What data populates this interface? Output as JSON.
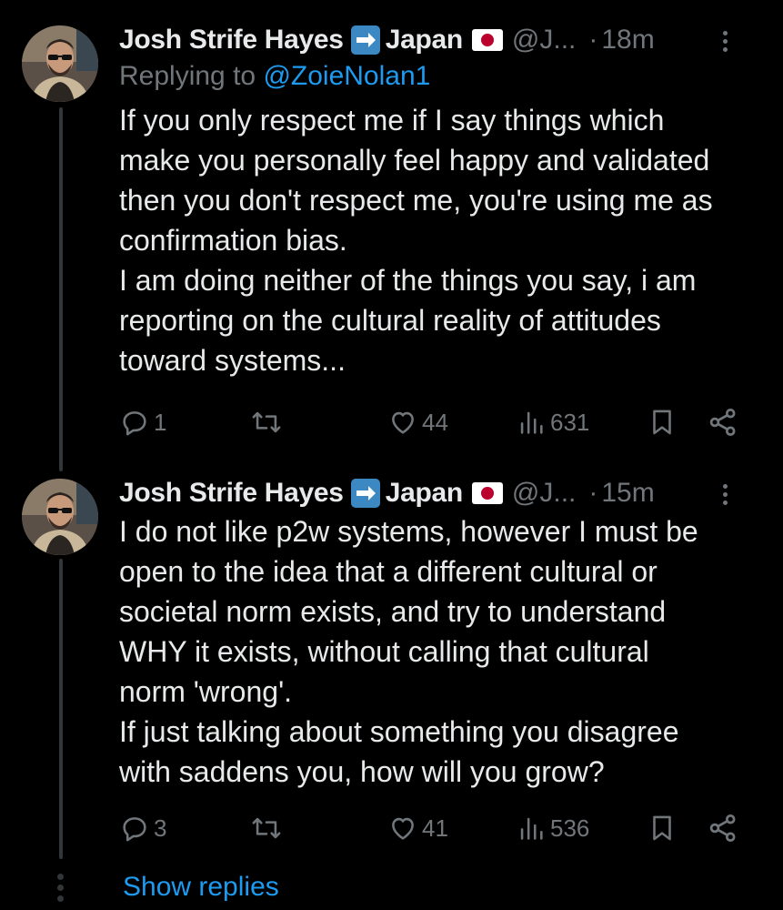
{
  "tweets": [
    {
      "author": {
        "name": "Josh Strife Hayes",
        "arrow_emoji": "right-arrow-emoji",
        "location": "Japan",
        "flag_emoji": "japan-flag-emoji",
        "handle": "@J...",
        "separator": "·",
        "time": "18m"
      },
      "reply_to": {
        "prefix": "Replying to ",
        "mention": "@ZoieNolan1"
      },
      "text": "If you only respect me if I say things which\nmake you personally feel happy and validated\nthen you don't respect me, you're using me as\nconfirmation bias.\nI am doing neither of the things you say, i am\nreporting on the cultural reality of attitudes\ntoward systems...",
      "actions": {
        "replies": "1",
        "reposts": "",
        "likes": "44",
        "views": "631"
      }
    },
    {
      "author": {
        "name": "Josh Strife Hayes",
        "arrow_emoji": "right-arrow-emoji",
        "location": "Japan",
        "flag_emoji": "japan-flag-emoji",
        "handle": "@J...",
        "separator": "·",
        "time": "15m"
      },
      "text": "I do not like p2w systems, however I must be\nopen to the idea that a different cultural or\nsocietal norm exists, and try to understand\nWHY it exists, without calling that cultural\nnorm 'wrong'.\nIf just talking about something you disagree\nwith saddens you, how will you grow?",
      "actions": {
        "replies": "3",
        "reposts": "",
        "likes": "41",
        "views": "536"
      }
    }
  ],
  "show_replies_label": "Show replies",
  "colors": {
    "background": "#000000",
    "text": "#e7e9ea",
    "muted": "#71767b",
    "accent": "#1d9bf0",
    "thread_line": "#333639"
  },
  "icons": [
    "reply-icon",
    "repost-icon",
    "like-icon",
    "views-icon",
    "bookmark-icon",
    "share-icon",
    "more-options-icon"
  ]
}
